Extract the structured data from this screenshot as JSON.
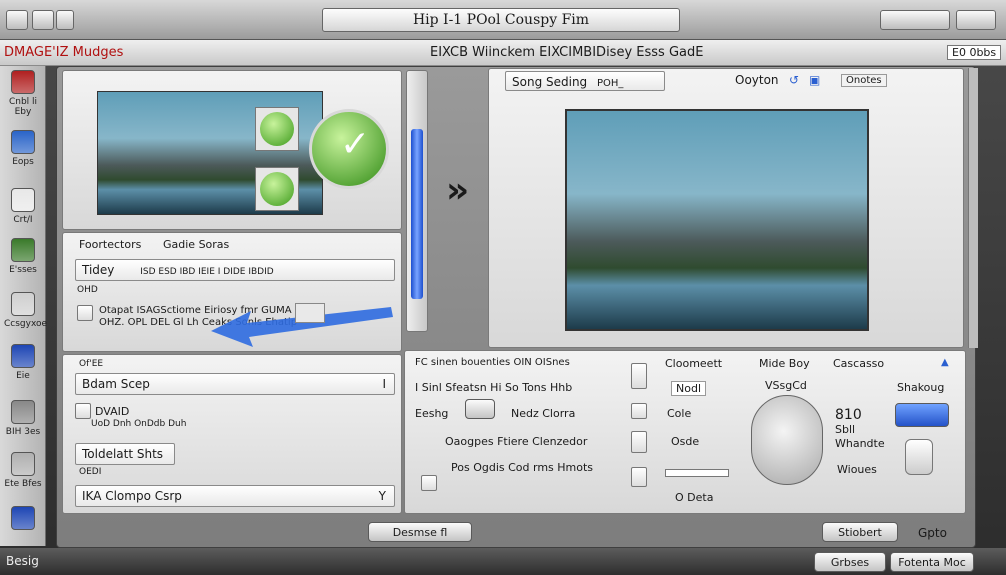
{
  "window": {
    "title": "Hip I-1 POol Couspy Fim"
  },
  "menubar": {
    "left": "DMAGE'IZ Mudges",
    "center": "EIXCB Wiinckem EIXCIMBIDisey Esss GadE",
    "right": "E0 0bbs"
  },
  "dock": {
    "items": [
      {
        "label": "Cnbl li Eby",
        "icon": "app-icon",
        "color": "#b02020"
      },
      {
        "label": "Eops",
        "icon": "folder-icon",
        "color": "#2a64c8"
      },
      {
        "label": "Crt/I",
        "icon": "document-icon",
        "color": "#e8e8e8"
      },
      {
        "label": "E'sses",
        "icon": "plant-icon",
        "color": "#3a7a2a"
      },
      {
        "label": "Ccsgyxoe",
        "icon": "window-icon",
        "color": "#cfcfcf"
      },
      {
        "label": "Eie",
        "icon": "bottle-icon",
        "color": "#1e46b4"
      },
      {
        "label": "BIH 3es",
        "icon": "disk-icon",
        "color": "#888888"
      },
      {
        "label": "Ete Bfes",
        "icon": "drive-icon",
        "color": "#b0b0b0"
      },
      {
        "label": "",
        "icon": "bottle-icon",
        "color": "#1e46b4"
      }
    ]
  },
  "left_panel": {
    "header_a": "Foortectors",
    "header_b": "Gadie Soras",
    "field1": "Tidey",
    "field1_tail": "ISD ESD IBD IEIE I DIDE IBDID",
    "small1": "OHD",
    "arrow_text": "Otapat ISAGSctiome Eiriosy fmr GUMA OHZ. OPL DEL Gl Lh Ceaks Sonls Ehatip",
    "list_hdr": "Of'EE",
    "field2": "Bdam Scep",
    "field2_arrow": "I",
    "item_a": "DVAID",
    "item_a_sub": "UoD Dnh OnDdb Duh",
    "field3": "Toldelatt Shts",
    "field3_sub": "OEDI",
    "field4": "IKA Clompo Csrp",
    "field4_arrow": "Y"
  },
  "right_header": {
    "label": "Song Seding",
    "tag": "POH_",
    "right": "Ooyton",
    "badge": "Onotes"
  },
  "nav": {
    "arrow": "»"
  },
  "lower_panel": {
    "row0": "FC sinen bouenties OIN OISnes",
    "row1": "I Sinl Sfeatsn Hi So  Tons Hhb",
    "row2_a": "Eeshg",
    "row2_b": "Nedz Clorra",
    "row3": "Oaogpes Ftiere Clenzedor",
    "row4": "Pos Ogdis Cod rms Hmots",
    "col2_head": "Cloomeett",
    "col2_r1": "Nodl",
    "col2_r2": "Cole",
    "col2_r3": "Osde",
    "col2_r4": "O Deta",
    "col3_head": "Mide Boy",
    "col3_r1": "VSsgCd",
    "col4_head": "Cascasso",
    "col4_r1": "Shakoug",
    "col4_r2": "810",
    "col4_r3": "Sbll",
    "col4_r4": "Whandte",
    "col4_r5": "Wioues"
  },
  "bottom": {
    "center_button": "Desmse fl",
    "right_a": "Stiobert",
    "right_b": "Gpto",
    "status": "Besig",
    "btn_a": "Grbses",
    "btn_b": "Fotenta Moc"
  }
}
